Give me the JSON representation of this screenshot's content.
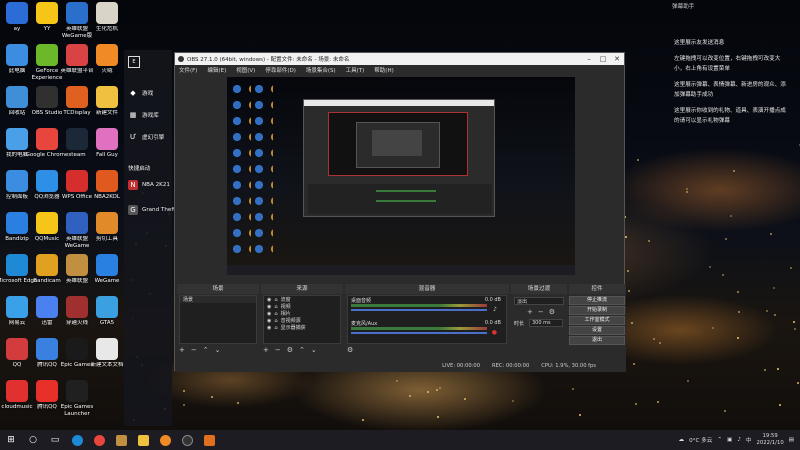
{
  "desktop": {
    "icons": [
      {
        "label": "ay",
        "color": "#2b6cd6"
      },
      {
        "label": "YY",
        "color": "#f5c518"
      },
      {
        "label": "英雄联盟WeGame版",
        "color": "#2a6fcb"
      },
      {
        "label": "生化危机",
        "color": "#d9d4c8"
      },
      {
        "label": "此电脑",
        "color": "#3a8de0"
      },
      {
        "label": "GeForce Experience",
        "color": "#6bb82a"
      },
      {
        "label": "英雄联盟平台",
        "color": "#d94343"
      },
      {
        "label": "火绒",
        "color": "#f08a24"
      },
      {
        "label": "回收站",
        "color": "#3f8fd8"
      },
      {
        "label": "OBS Studio",
        "color": "#303030"
      },
      {
        "label": "TCDisplay",
        "color": "#e06020"
      },
      {
        "label": "新建文件",
        "color": "#f0c040"
      },
      {
        "label": "我的电脑",
        "color": "#4aa0e8"
      },
      {
        "label": "Google Chrome",
        "color": "#e8453c"
      },
      {
        "label": "steam",
        "color": "#1b2838"
      },
      {
        "label": "Fall Guy",
        "color": "#e070c0"
      },
      {
        "label": "控制面板",
        "color": "#3a8de0"
      },
      {
        "label": "QQ浏览器",
        "color": "#2e8fe6"
      },
      {
        "label": "WPS Office",
        "color": "#d62d2d"
      },
      {
        "label": "NBA2KOL",
        "color": "#e05a20"
      },
      {
        "label": "Bandizip",
        "color": "#2a7fe0"
      },
      {
        "label": "QQMusic",
        "color": "#f5c518"
      },
      {
        "label": "英雄联盟WeGame",
        "color": "#3060c0"
      },
      {
        "label": "剪切工具",
        "color": "#e08a2a"
      },
      {
        "label": "Microsoft Edge",
        "color": "#1e8ad6"
      },
      {
        "label": "Bandicam",
        "color": "#e0a020"
      },
      {
        "label": "英雄联盟",
        "color": "#c09040"
      },
      {
        "label": "WeGame",
        "color": "#2a80e0"
      },
      {
        "label": "网易云",
        "color": "#3aa0e8"
      },
      {
        "label": "迅雷",
        "color": "#4a80f0"
      },
      {
        "label": "穿越火线",
        "color": "#a03030"
      },
      {
        "label": "GTA5",
        "color": "#3aa0e0"
      },
      {
        "label": "QQ",
        "color": "#d33c3c"
      },
      {
        "label": "腾讯QQ",
        "color": "#3a80e0"
      },
      {
        "label": "Epic Games",
        "color": "#1a1a1a"
      },
      {
        "label": "新建文本文档",
        "color": "#e8e8e8"
      },
      {
        "label": "cloudmusic",
        "color": "#e03030"
      },
      {
        "label": "腾讯QQ",
        "color": "#e8302a"
      },
      {
        "label": "Epic Games Launcher",
        "color": "#202020"
      }
    ]
  },
  "notifications": {
    "header": "弹幕助手",
    "lines": [
      "这里展示友发送消息",
      "左键拖拽可以改变位置，右键拖拽可改变大小，右上角有设置菜单",
      "这里展示弹幕、表情弹幕、新进房的观众、添加弹幕助手成功",
      "这里展示你收到的礼物、道具、表演开播点成的请可以显示礼物弹幕"
    ]
  },
  "start_menu": {
    "items": [
      {
        "label": "游戏",
        "icon": "game-icon"
      },
      {
        "label": "游戏库",
        "icon": "library-icon"
      },
      {
        "label": "虚幻引擎",
        "icon": "unreal-icon"
      },
      {
        "label": "快捷启动",
        "icon": ""
      },
      {
        "label": "NBA 2K21",
        "icon": "nba-icon"
      },
      {
        "label": "Grand Theft",
        "icon": "gta-icon"
      }
    ]
  },
  "obs": {
    "title": "OBS 27.1.0 (64bit, windows) - 配置文件: 未命名 - 场景: 未命名",
    "menu": [
      "文件(F)",
      "编辑(E)",
      "视图(V)",
      "停靠部件(D)",
      "场景集合(S)",
      "工具(T)",
      "帮助(H)"
    ],
    "docks": {
      "scenes": {
        "title": "场景",
        "items": [
          "场景"
        ]
      },
      "sources": {
        "title": "来源",
        "items": [
          "流窗",
          "视频",
          "相片",
          "音视频源",
          "显示器捕获"
        ]
      },
      "mixer": {
        "title": "混音器",
        "channels": [
          {
            "name": "桌面音频",
            "level": "0.0 dB"
          },
          {
            "name": "麦克风/Aux",
            "level": "0.0 dB"
          }
        ]
      },
      "transitions": {
        "title": "场景过渡",
        "type": "淡出",
        "duration_label": "时长",
        "duration": "300 ms"
      },
      "controls": {
        "title": "控件",
        "buttons": [
          "停止推流",
          "开始录制",
          "工作室模式",
          "设置",
          "退出"
        ]
      }
    },
    "status": {
      "live": "LIVE: 00:00:00",
      "rec": "REC: 00:00:00",
      "cpu": "CPU: 1.9%, 30.00 fps"
    }
  },
  "taskbar": {
    "weather": "0°C 多云",
    "time": "19:59",
    "date": "2022/1/10"
  }
}
